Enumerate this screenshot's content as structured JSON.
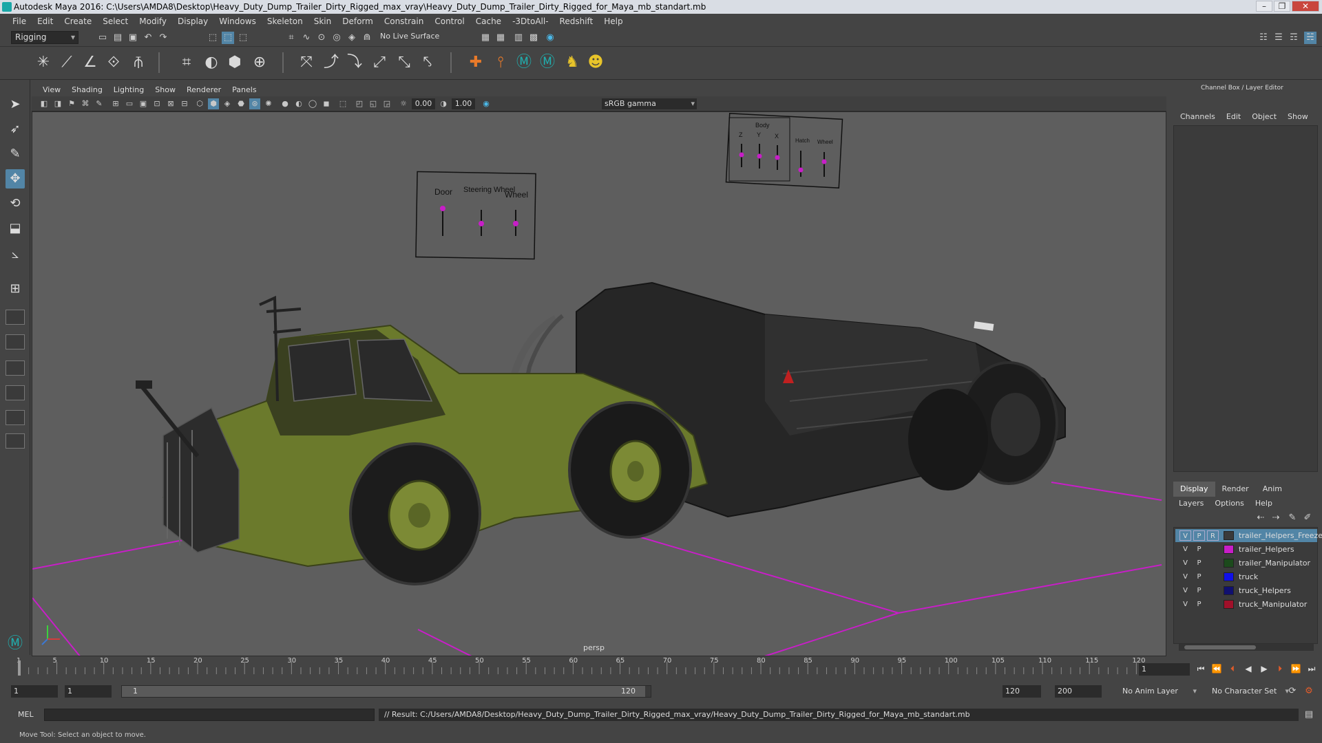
{
  "window": {
    "title": "Autodesk Maya 2016: C:\\Users\\AMDA8\\Desktop\\Heavy_Duty_Dump_Trailer_Dirty_Rigged_max_vray\\Heavy_Duty_Dump_Trailer_Dirty_Rigged_for_Maya_mb_standart.mb"
  },
  "menubar": [
    "File",
    "Edit",
    "Create",
    "Select",
    "Modify",
    "Display",
    "Windows",
    "Skeleton",
    "Skin",
    "Deform",
    "Constrain",
    "Control",
    "Cache",
    "-3DtoAll-",
    "Redshift",
    "Help"
  ],
  "statusline": {
    "mode": "Rigging",
    "live_surface": "No Live Surface"
  },
  "panel": {
    "menu": [
      "View",
      "Shading",
      "Lighting",
      "Show",
      "Renderer",
      "Panels"
    ],
    "exposure": "0.00",
    "gamma": "1.00",
    "colorspace": "sRGB gamma",
    "camera": "persp"
  },
  "controls": {
    "panel1": {
      "labels": [
        "Door",
        "Steering Wheel",
        "Wheel"
      ]
    },
    "panel2": {
      "title": "Body",
      "labels": [
        "Z",
        "Y",
        "X",
        "Hatch",
        "Wheel"
      ]
    }
  },
  "channelbox": {
    "header": "Channel Box / Layer Editor",
    "menu": [
      "Channels",
      "Edit",
      "Object",
      "Show"
    ]
  },
  "layers": {
    "tabs": [
      "Display",
      "Render",
      "Anim"
    ],
    "menu": [
      "Layers",
      "Options",
      "Help"
    ],
    "items": [
      {
        "v": "V",
        "p": "P",
        "r": "R",
        "name": "trailer_Helpers_Freeze",
        "color": "#3a3a3a",
        "selected": true
      },
      {
        "v": "V",
        "p": "P",
        "r": "",
        "name": "trailer_Helpers",
        "color": "#c81ec8"
      },
      {
        "v": "V",
        "p": "P",
        "r": "",
        "name": "trailer_Manipulator",
        "color": "#1c4a1c"
      },
      {
        "v": "V",
        "p": "P",
        "r": "",
        "name": "truck",
        "color": "#1010e8"
      },
      {
        "v": "V",
        "p": "P",
        "r": "",
        "name": "truck_Helpers",
        "color": "#101070"
      },
      {
        "v": "V",
        "p": "P",
        "r": "",
        "name": "truck_Manipulator",
        "color": "#a0102a"
      }
    ]
  },
  "timeline": {
    "ticks": [
      "1",
      "5",
      "10",
      "15",
      "20",
      "25",
      "30",
      "35",
      "40",
      "45",
      "50",
      "55",
      "60",
      "65",
      "70",
      "75",
      "80",
      "85",
      "90",
      "95",
      "100",
      "105",
      "110",
      "115",
      "120"
    ],
    "current_frame": "1"
  },
  "range": {
    "start": "1",
    "anim_start": "1",
    "range_start": "1",
    "range_end": "120",
    "end": "120",
    "anim_end": "200",
    "anim_layer": "No Anim Layer",
    "character_set": "No Character Set"
  },
  "command": {
    "lang": "MEL",
    "result": "// Result: C:/Users/AMDA8/Desktop/Heavy_Duty_Dump_Trailer_Dirty_Rigged_max_vray/Heavy_Duty_Dump_Trailer_Dirty_Rigged_for_Maya_mb_standart.mb"
  },
  "helpline": "Move Tool: Select an object to move.",
  "colors": {
    "accent": "#5285a6",
    "manipulator": "#c81ec8",
    "truck_body": "#6b7a2c",
    "trailer": "#262626"
  }
}
